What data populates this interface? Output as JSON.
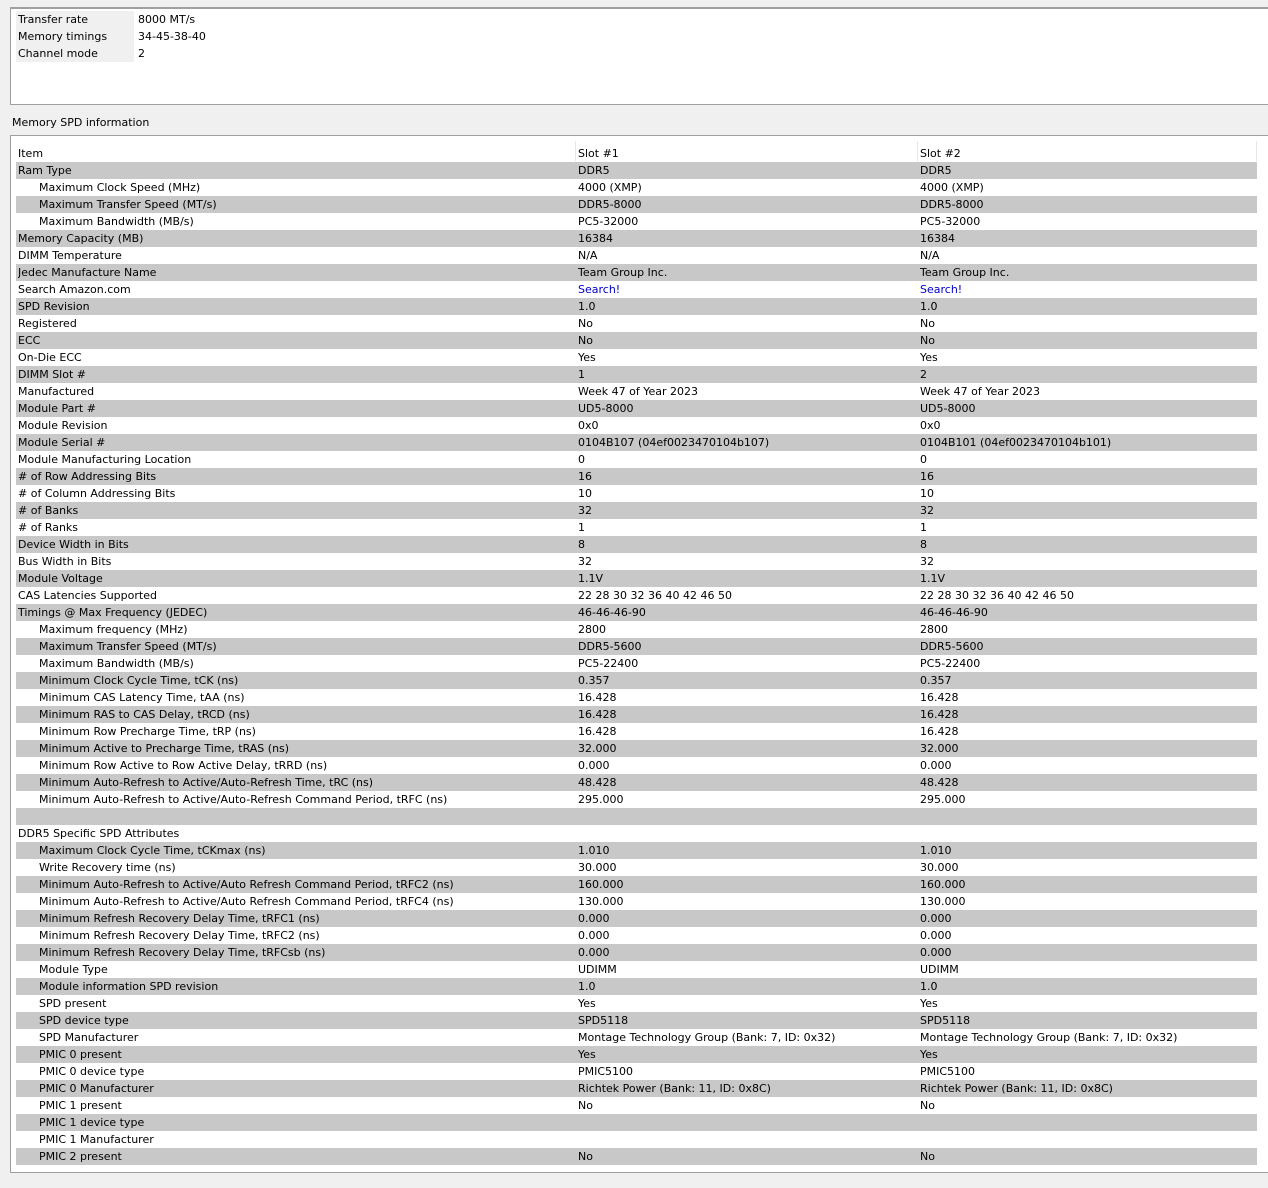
{
  "summary": [
    {
      "label": "Transfer rate",
      "value": "8000 MT/s"
    },
    {
      "label": "Memory timings",
      "value": "34-45-38-40"
    },
    {
      "label": "Channel mode",
      "value": "2"
    }
  ],
  "section_title": "Memory SPD information",
  "columns": {
    "item": "Item",
    "slot1": "Slot #1",
    "slot2": "Slot #2"
  },
  "rows": [
    {
      "item": "Ram Type",
      "s1": "DDR5",
      "s2": "DDR5",
      "indent": false,
      "shaded": true
    },
    {
      "item": "Maximum Clock Speed (MHz)",
      "s1": "4000 (XMP)",
      "s2": "4000 (XMP)",
      "indent": true,
      "shaded": false
    },
    {
      "item": "Maximum Transfer Speed (MT/s)",
      "s1": "DDR5-8000",
      "s2": "DDR5-8000",
      "indent": true,
      "shaded": true
    },
    {
      "item": "Maximum Bandwidth (MB/s)",
      "s1": "PC5-32000",
      "s2": "PC5-32000",
      "indent": true,
      "shaded": false
    },
    {
      "item": "Memory Capacity (MB)",
      "s1": "16384",
      "s2": "16384",
      "indent": false,
      "shaded": true
    },
    {
      "item": "DIMM Temperature",
      "s1": "N/A",
      "s2": "N/A",
      "indent": false,
      "shaded": false
    },
    {
      "item": "Jedec Manufacture Name",
      "s1": "Team Group Inc.",
      "s2": "Team Group Inc.",
      "indent": false,
      "shaded": true
    },
    {
      "item": "Search Amazon.com",
      "s1": "Search!",
      "s2": "Search!",
      "indent": false,
      "shaded": false,
      "link": true
    },
    {
      "item": "SPD Revision",
      "s1": "1.0",
      "s2": "1.0",
      "indent": false,
      "shaded": true
    },
    {
      "item": "Registered",
      "s1": "No",
      "s2": "No",
      "indent": false,
      "shaded": false
    },
    {
      "item": "ECC",
      "s1": "No",
      "s2": "No",
      "indent": false,
      "shaded": true
    },
    {
      "item": "On-Die ECC",
      "s1": "Yes",
      "s2": "Yes",
      "indent": false,
      "shaded": false
    },
    {
      "item": "DIMM Slot #",
      "s1": "1",
      "s2": "2",
      "indent": false,
      "shaded": true
    },
    {
      "item": "Manufactured",
      "s1": "Week 47 of Year 2023",
      "s2": "Week 47 of Year 2023",
      "indent": false,
      "shaded": false
    },
    {
      "item": "Module Part #",
      "s1": "UD5-8000",
      "s2": "UD5-8000",
      "indent": false,
      "shaded": true
    },
    {
      "item": "Module Revision",
      "s1": "0x0",
      "s2": "0x0",
      "indent": false,
      "shaded": false
    },
    {
      "item": "Module Serial #",
      "s1": "0104B107 (04ef0023470104b107)",
      "s2": "0104B101 (04ef0023470104b101)",
      "indent": false,
      "shaded": true
    },
    {
      "item": "Module Manufacturing Location",
      "s1": "0",
      "s2": "0",
      "indent": false,
      "shaded": false
    },
    {
      "item": "# of Row Addressing Bits",
      "s1": "16",
      "s2": "16",
      "indent": false,
      "shaded": true
    },
    {
      "item": "# of Column Addressing Bits",
      "s1": "10",
      "s2": "10",
      "indent": false,
      "shaded": false
    },
    {
      "item": "# of Banks",
      "s1": "32",
      "s2": "32",
      "indent": false,
      "shaded": true
    },
    {
      "item": "# of Ranks",
      "s1": "1",
      "s2": "1",
      "indent": false,
      "shaded": false
    },
    {
      "item": "Device Width in Bits",
      "s1": "8",
      "s2": "8",
      "indent": false,
      "shaded": true
    },
    {
      "item": "Bus Width in Bits",
      "s1": "32",
      "s2": "32",
      "indent": false,
      "shaded": false
    },
    {
      "item": "Module Voltage",
      "s1": "1.1V",
      "s2": "1.1V",
      "indent": false,
      "shaded": true
    },
    {
      "item": "CAS Latencies Supported",
      "s1": "22 28 30 32 36 40 42 46 50",
      "s2": "22 28 30 32 36 40 42 46 50",
      "indent": false,
      "shaded": false
    },
    {
      "item": "Timings @ Max Frequency (JEDEC)",
      "s1": "46-46-46-90",
      "s2": "46-46-46-90",
      "indent": false,
      "shaded": true
    },
    {
      "item": "Maximum frequency (MHz)",
      "s1": "2800",
      "s2": "2800",
      "indent": true,
      "shaded": false
    },
    {
      "item": "Maximum Transfer Speed (MT/s)",
      "s1": "DDR5-5600",
      "s2": "DDR5-5600",
      "indent": true,
      "shaded": true
    },
    {
      "item": "Maximum Bandwidth (MB/s)",
      "s1": "PC5-22400",
      "s2": "PC5-22400",
      "indent": true,
      "shaded": false
    },
    {
      "item": "Minimum Clock Cycle Time, tCK (ns)",
      "s1": "0.357",
      "s2": "0.357",
      "indent": true,
      "shaded": true
    },
    {
      "item": "Minimum CAS Latency Time, tAA (ns)",
      "s1": "16.428",
      "s2": "16.428",
      "indent": true,
      "shaded": false
    },
    {
      "item": "Minimum RAS to CAS Delay, tRCD (ns)",
      "s1": "16.428",
      "s2": "16.428",
      "indent": true,
      "shaded": true
    },
    {
      "item": "Minimum Row Precharge Time, tRP (ns)",
      "s1": "16.428",
      "s2": "16.428",
      "indent": true,
      "shaded": false
    },
    {
      "item": "Minimum Active to Precharge Time, tRAS (ns)",
      "s1": "32.000",
      "s2": "32.000",
      "indent": true,
      "shaded": true
    },
    {
      "item": "Minimum Row Active to Row Active Delay, tRRD (ns)",
      "s1": "0.000",
      "s2": "0.000",
      "indent": true,
      "shaded": false
    },
    {
      "item": "Minimum Auto-Refresh to Active/Auto-Refresh Time, tRC (ns)",
      "s1": "48.428",
      "s2": "48.428",
      "indent": true,
      "shaded": true
    },
    {
      "item": "Minimum Auto-Refresh to Active/Auto-Refresh Command Period, tRFC (ns)",
      "s1": "295.000",
      "s2": "295.000",
      "indent": true,
      "shaded": false
    },
    {
      "item": "",
      "s1": "",
      "s2": "",
      "indent": false,
      "shaded": true
    },
    {
      "item": "DDR5 Specific SPD Attributes",
      "s1": "",
      "s2": "",
      "indent": false,
      "shaded": false
    },
    {
      "item": "Maximum Clock Cycle Time, tCKmax (ns)",
      "s1": "1.010",
      "s2": "1.010",
      "indent": true,
      "shaded": true
    },
    {
      "item": "Write Recovery time (ns)",
      "s1": "30.000",
      "s2": "30.000",
      "indent": true,
      "shaded": false
    },
    {
      "item": "Minimum Auto-Refresh to Active/Auto Refresh Command Period, tRFC2 (ns)",
      "s1": "160.000",
      "s2": "160.000",
      "indent": true,
      "shaded": true
    },
    {
      "item": "Minimum Auto-Refresh to Active/Auto Refresh Command Period, tRFC4 (ns)",
      "s1": "130.000",
      "s2": "130.000",
      "indent": true,
      "shaded": false
    },
    {
      "item": "Minimum Refresh Recovery Delay Time, tRFC1 (ns)",
      "s1": "0.000",
      "s2": "0.000",
      "indent": true,
      "shaded": true
    },
    {
      "item": "Minimum Refresh Recovery Delay Time, tRFC2 (ns)",
      "s1": "0.000",
      "s2": "0.000",
      "indent": true,
      "shaded": false
    },
    {
      "item": "Minimum Refresh Recovery Delay Time, tRFCsb (ns)",
      "s1": "0.000",
      "s2": "0.000",
      "indent": true,
      "shaded": true
    },
    {
      "item": "Module Type",
      "s1": "UDIMM",
      "s2": "UDIMM",
      "indent": true,
      "shaded": false
    },
    {
      "item": "Module information SPD revision",
      "s1": "1.0",
      "s2": "1.0",
      "indent": true,
      "shaded": true
    },
    {
      "item": "SPD present",
      "s1": "Yes",
      "s2": "Yes",
      "indent": true,
      "shaded": false
    },
    {
      "item": "SPD device type",
      "s1": "SPD5118",
      "s2": "SPD5118",
      "indent": true,
      "shaded": true
    },
    {
      "item": "SPD Manufacturer",
      "s1": "Montage Technology Group (Bank: 7, ID: 0x32)",
      "s2": "Montage Technology Group (Bank: 7, ID: 0x32)",
      "indent": true,
      "shaded": false
    },
    {
      "item": "PMIC 0 present",
      "s1": "Yes",
      "s2": "Yes",
      "indent": true,
      "shaded": true
    },
    {
      "item": "PMIC 0 device type",
      "s1": "PMIC5100",
      "s2": "PMIC5100",
      "indent": true,
      "shaded": false
    },
    {
      "item": "PMIC 0 Manufacturer",
      "s1": "Richtek Power (Bank: 11, ID: 0x8C)",
      "s2": "Richtek Power (Bank: 11, ID: 0x8C)",
      "indent": true,
      "shaded": true
    },
    {
      "item": "PMIC 1 present",
      "s1": "No",
      "s2": "No",
      "indent": true,
      "shaded": false
    },
    {
      "item": "PMIC 1 device type",
      "s1": "",
      "s2": "",
      "indent": true,
      "shaded": true
    },
    {
      "item": "PMIC 1 Manufacturer",
      "s1": "",
      "s2": "",
      "indent": true,
      "shaded": false
    },
    {
      "item": "PMIC 2 present",
      "s1": "No",
      "s2": "No",
      "indent": true,
      "shaded": true
    }
  ]
}
